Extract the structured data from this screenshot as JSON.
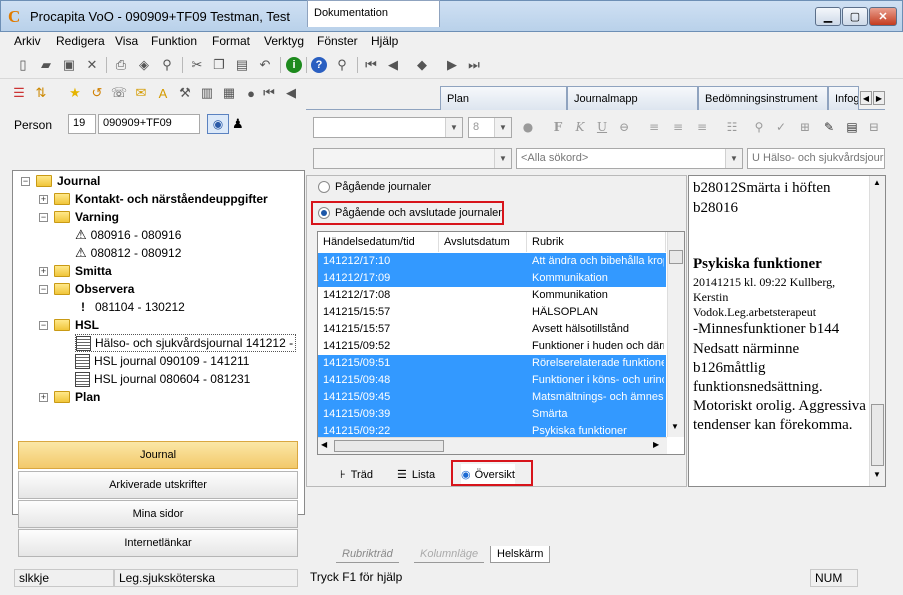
{
  "window": {
    "title": "Procapita VoO - 090909+TF09 Testman, Test",
    "logo": "C"
  },
  "menu": [
    "Arkiv",
    "Redigera",
    "Visa",
    "Funktion",
    "Format",
    "Verktyg",
    "Fönster",
    "Hjälp"
  ],
  "person": {
    "label": "Person",
    "century": "19",
    "number": "090909+TF09"
  },
  "tree": {
    "root": "Journal",
    "items": [
      {
        "label": "Kontakt- och närståendeuppgifter"
      },
      {
        "label": "Varning"
      },
      {
        "label": "080916 - 080916"
      },
      {
        "label": "080812 - 080912"
      },
      {
        "label": "Smitta"
      },
      {
        "label": "Observera"
      },
      {
        "label": "081104 - 130212"
      },
      {
        "label": "HSL"
      },
      {
        "label": "Hälso- och sjukvårdsjournal 141212 -"
      },
      {
        "label": "HSL journal 090109 - 141211"
      },
      {
        "label": "HSL journal 080604 - 081231"
      },
      {
        "label": "Plan"
      }
    ]
  },
  "nav_buttons": [
    "Journal",
    "Arkiverade utskrifter",
    "Mina sidor",
    "Internetlänkar"
  ],
  "tabs": [
    "Dokumentation",
    "Plan",
    "Journalmapp",
    "Bedömningsinstrument",
    "Infog"
  ],
  "toolbar2": {
    "font_size": "8",
    "search_placeholder": "<Alla sökord>",
    "journal_combo": "U Hälso- och sjukvårdsjourn"
  },
  "radios": {
    "option1": "Pågående journaler",
    "option2": "Pågående och avslutade journaler"
  },
  "list": {
    "headers": [
      "Händelsedatum/tid",
      "Avslutsdatum",
      "Rubrik"
    ],
    "rows": [
      {
        "date": "141212/17:10",
        "rubrik": "Att ändra och bibehålla kropp",
        "selected": true
      },
      {
        "date": "141212/17:09",
        "rubrik": "Kommunikation",
        "selected": true
      },
      {
        "date": "141212/17:08",
        "rubrik": "Kommunikation",
        "selected": false
      },
      {
        "date": "141215/15:57",
        "rubrik": "HÄLSOPLAN",
        "selected": false
      },
      {
        "date": "141215/15:57",
        "rubrik": "Avsett hälsotillstånd",
        "selected": false
      },
      {
        "date": "141215/09:52",
        "rubrik": "Funktioner i huden och därm",
        "selected": false
      },
      {
        "date": "141215/09:51",
        "rubrik": "Rörelserelaterade funktioner",
        "selected": true
      },
      {
        "date": "141215/09:48",
        "rubrik": "Funktioner i köns- och urinor",
        "selected": true
      },
      {
        "date": "141215/09:45",
        "rubrik": "Matsmältnings- och ämnesor",
        "selected": true
      },
      {
        "date": "141215/09:39",
        "rubrik": "Smärta",
        "selected": true
      },
      {
        "date": "141215/09:22",
        "rubrik": "Psykiska funktioner",
        "selected": true
      }
    ]
  },
  "view_tabs": [
    "Träd",
    "Lista",
    "Översikt"
  ],
  "bottom_tabs": [
    "Rubrikträd",
    "Kolumnläge",
    "Helskärm"
  ],
  "document": {
    "line1": "b28012Smärta i höften",
    "line2": "b28016",
    "heading": "Psykiska funktioner",
    "meta1": "20141215 kl. 09:22   Kullberg,",
    "meta2": "Kerstin",
    "meta3": "Vodok.Leg.arbetsterapeut",
    "body": [
      " -Minnesfunktioner b144",
      "Nedsatt närminne",
      "b126måttlig",
      "funktionsnedsättning.",
      "Motoriskt orolig. Aggressiva",
      "tendenser kan förekomma."
    ]
  },
  "status": {
    "user": "slkkje",
    "role": "Leg.sjuksköterska",
    "help": "Tryck F1 för hjälp",
    "num": "NUM"
  }
}
